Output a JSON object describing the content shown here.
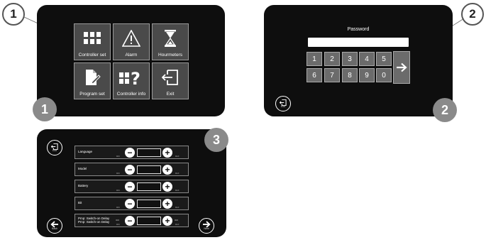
{
  "callouts": {
    "one": "1",
    "two": "2"
  },
  "badges": {
    "one": "1",
    "two": "2",
    "three": "3"
  },
  "menu": {
    "tiles": [
      {
        "label": "Controller set",
        "icon": "grid-icon"
      },
      {
        "label": "Alarm",
        "icon": "warning-icon"
      },
      {
        "label": "Hourmeters",
        "icon": "hourglass-icon"
      },
      {
        "label": "Program set",
        "icon": "document-edit-icon"
      },
      {
        "label": "Controller info",
        "icon": "grid-question-icon"
      },
      {
        "label": "Exit",
        "icon": "exit-icon"
      }
    ]
  },
  "password": {
    "label": "Password",
    "field_value": "",
    "keys": [
      "1",
      "2",
      "3",
      "4",
      "5",
      "6",
      "7",
      "8",
      "9",
      "0"
    ],
    "enter_icon": "arrow-right-icon",
    "exit_caption": "Exit"
  },
  "settings": {
    "exit_caption": "Exit",
    "back_caption": "Back",
    "next_caption": "Next",
    "rows": [
      {
        "label": "Language",
        "min": "MIN",
        "max": "MAX",
        "value": ""
      },
      {
        "label": "Model",
        "min": "MIN",
        "max": "MAX",
        "value": ""
      },
      {
        "label": "Battery",
        "min": "MIN",
        "max": "MAX",
        "value": ""
      },
      {
        "label": "Bit",
        "min": "MIN",
        "max": "MAX",
        "value": ""
      },
      {
        "label": "Pmp: Switch-on Delay\nPmp: Switch-on Delay",
        "min": "MIN",
        "max": "MAX",
        "value": "",
        "left_unit": "000",
        "right_unit": "000"
      }
    ]
  },
  "colors": {
    "panel": "#0e0e0e",
    "tile": "#4a4a4a",
    "badge": "#8a8a8a"
  }
}
